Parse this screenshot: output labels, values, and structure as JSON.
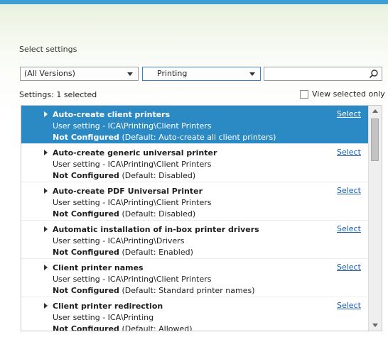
{
  "accent": "#2b8ac4",
  "section_title": "Select settings",
  "filters": {
    "version_dropdown": "(All Versions)",
    "category_dropdown": "Printing",
    "search_value": "",
    "search_icon": "magnifier-icon"
  },
  "settings_count": {
    "label": "Settings:",
    "value": "1 selected"
  },
  "view_selected_only": {
    "label": "View selected only",
    "checked": false
  },
  "settings": [
    {
      "name": "Auto-create client printers",
      "path": "User setting - ICA\\Printing\\Client Printers",
      "status": "Not Configured",
      "default": "(Default: Auto-create all client printers)",
      "action": "Select"
    },
    {
      "name": "Auto-create generic universal printer",
      "path": "User setting - ICA\\Printing\\Client Printers",
      "status": "Not Configured",
      "default": "(Default: Disabled)",
      "action": "Select"
    },
    {
      "name": "Auto-create PDF Universal Printer",
      "path": "User setting - ICA\\Printing\\Client Printers",
      "status": "Not Configured",
      "default": "(Default: Disabled)",
      "action": "Select"
    },
    {
      "name": "Automatic installation of in-box printer drivers",
      "path": "User setting - ICA\\Printing\\Drivers",
      "status": "Not Configured",
      "default": "(Default: Enabled)",
      "action": "Select"
    },
    {
      "name": "Client printer names",
      "path": "User setting - ICA\\Printing\\Client Printers",
      "status": "Not Configured",
      "default": "(Default: Standard printer names)",
      "action": "Select"
    },
    {
      "name": "Client printer redirection",
      "path": "User setting - ICA\\Printing",
      "status": "Not Configured",
      "default": "(Default: Allowed)",
      "action": "Select"
    }
  ]
}
